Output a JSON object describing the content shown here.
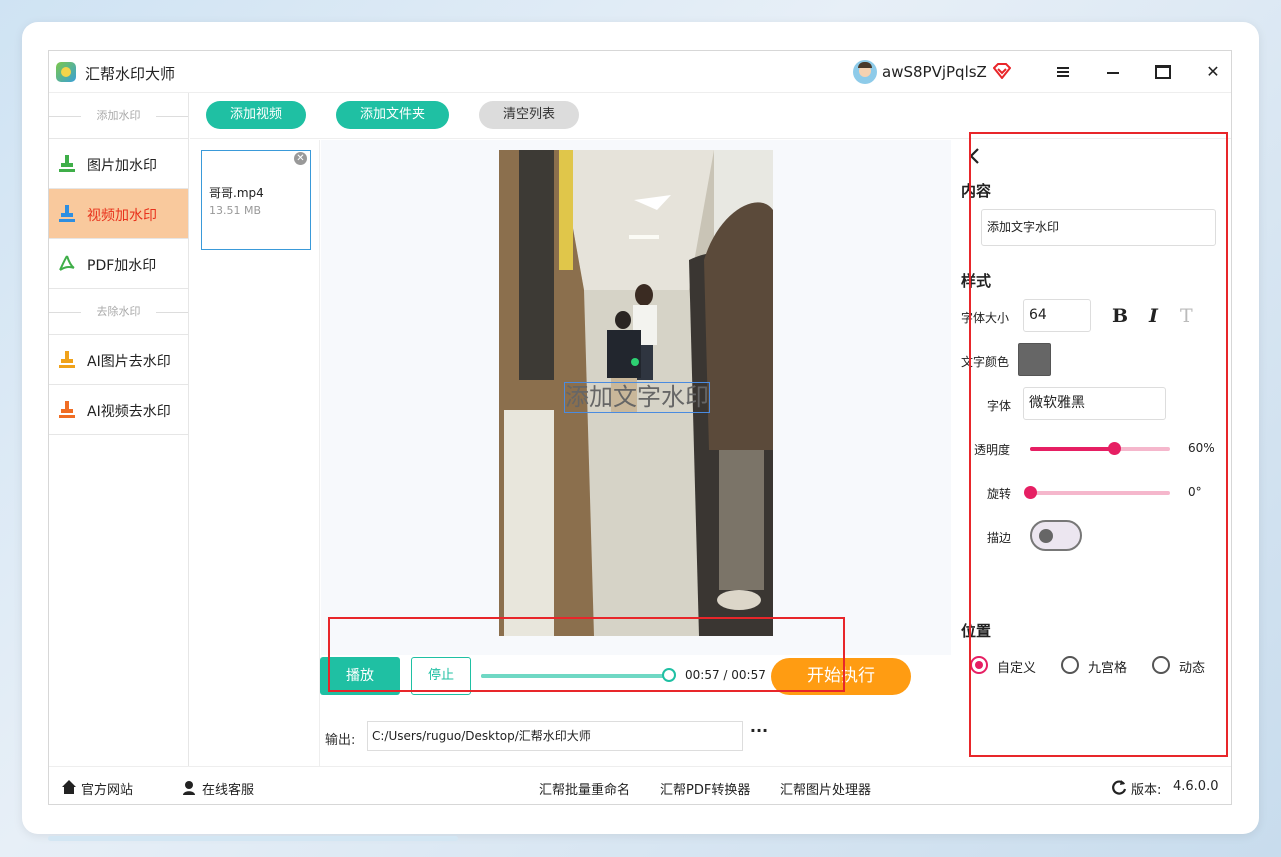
{
  "app": {
    "title": "汇帮水印大师",
    "username": "awS8PVjPqlsZ"
  },
  "sidebar": {
    "section_add": "添加水印",
    "section_remove": "去除水印",
    "items": [
      {
        "label": "图片加水印",
        "icon": "stamp-icon",
        "color": "#3fae49"
      },
      {
        "label": "视频加水印",
        "icon": "stamp-icon",
        "color": "#2e8ee0",
        "active": true
      },
      {
        "label": "PDF加水印",
        "icon": "pdf-icon",
        "color": "#3fae49"
      },
      {
        "label": "AI图片去水印",
        "icon": "stamp-icon",
        "color": "#f0a21a"
      },
      {
        "label": "AI视频去水印",
        "icon": "stamp-icon",
        "color": "#f06d24"
      }
    ]
  },
  "toolbar": {
    "add_video": "添加视频",
    "add_folder": "添加文件夹",
    "clear_list": "清空列表"
  },
  "files": [
    {
      "name": "哥哥.mp4",
      "size": "13.51 MB"
    }
  ],
  "preview": {
    "watermark_text": "添加文字水印"
  },
  "player": {
    "play": "播放",
    "stop": "停止",
    "time": "00:57 / 00:57",
    "progress": 1.0,
    "start": "开始执行"
  },
  "output": {
    "label": "输出:",
    "path": "C:/Users/ruguo/Desktop/汇帮水印大师",
    "more": "···"
  },
  "panel": {
    "content_title": "内容",
    "content_value": "添加文字水印",
    "style_title": "样式",
    "font_size_label": "字体大小",
    "font_size": "64",
    "bold": "B",
    "italic": "I",
    "text_format": "T",
    "color_label": "文字颜色",
    "text_color": "#666666",
    "font_label": "字体",
    "font_value": "微软雅黑",
    "opacity_label": "透明度",
    "opacity_value": "60%",
    "opacity": 0.6,
    "rotate_label": "旋转",
    "rotate_value": "0°",
    "rotate": 0,
    "stroke_label": "描边",
    "stroke_on": false,
    "position_title": "位置",
    "position_options": [
      "自定义",
      "九宫格",
      "动态"
    ],
    "position_selected": "自定义"
  },
  "footer": {
    "website": "官方网站",
    "support": "在线客服",
    "links": [
      "汇帮批量重命名",
      "汇帮PDF转换器",
      "汇帮图片处理器"
    ],
    "version_label": "版本:",
    "version": "4.6.0.0"
  },
  "colors": {
    "accent_green": "#1fc0a3",
    "accent_orange": "#ff9c12",
    "accent_pink": "#e61f63",
    "highlight_red": "#e8262a"
  }
}
